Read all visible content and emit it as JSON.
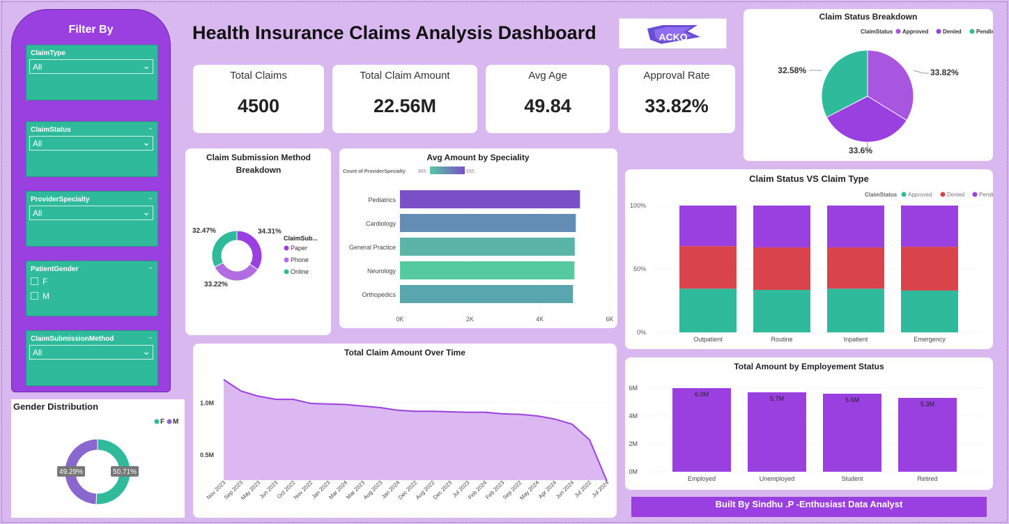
{
  "title": "Health Insurance Claims Analysis Dashboard",
  "logo_text": "ACKO",
  "colors": {
    "purple": "#9a3fe0",
    "teal": "#2fba9c",
    "red": "#d9434b",
    "light_purple": "#d9b8f0",
    "violet": "#a855e0"
  },
  "filter": {
    "title": "Filter By",
    "slicers": [
      {
        "label": "ClaimType",
        "value": "All"
      },
      {
        "label": "ClaimStatus",
        "value": "All"
      },
      {
        "label": "ProviderSpecialty",
        "value": "All"
      },
      {
        "label": "PatientGender",
        "options": [
          "F",
          "M"
        ]
      },
      {
        "label": "ClaimSubmissionMethod",
        "value": "All"
      }
    ]
  },
  "kpis": [
    {
      "label": "Total Claims",
      "value": "4500"
    },
    {
      "label": "Total Claim Amount",
      "value": "22.56M"
    },
    {
      "label": "Avg Age",
      "value": "49.84"
    },
    {
      "label": "Approval Rate",
      "value": "33.82%"
    }
  ],
  "footer": "Built By Sindhu .P -Enthusiast Data Analyst",
  "chart_data": [
    {
      "id": "claim_status_breakdown",
      "type": "pie",
      "title": "Claim Status Breakdown",
      "legend_title": "ClaimStatus",
      "legend_position": "top-right",
      "labels": [
        "Approved",
        "Denied",
        "Pending"
      ],
      "values": [
        33.82,
        33.6,
        32.58
      ],
      "value_labels": [
        "33.82%",
        "33.6%",
        "32.58%"
      ],
      "colors": [
        "#a855e0",
        "#9a3fe0",
        "#2fba9c"
      ]
    },
    {
      "id": "submission_method",
      "type": "pie",
      "title": "Claim Submission Method Breakdown",
      "legend_title": "ClaimSub...",
      "legend_position": "right",
      "labels": [
        "Paper",
        "Phone",
        "Online"
      ],
      "values": [
        34.31,
        33.22,
        32.47
      ],
      "value_labels": [
        "34.31%",
        "33.22%",
        "32.47%"
      ],
      "colors": [
        "#9a3fe0",
        "#b06ce0",
        "#2fba9c"
      ]
    },
    {
      "id": "avg_amount_speciality",
      "type": "bar",
      "orientation": "horizontal",
      "title": "Avg Amount by Speciality",
      "legend_title": "Count of ProviderSpecialty",
      "legend_range": [
        "865",
        "955"
      ],
      "categories": [
        "Pediatrics",
        "Cardiology",
        "General Practice",
        "Neurology",
        "Orthopedics"
      ],
      "values": [
        5150,
        5030,
        5000,
        4990,
        4950
      ],
      "colors": [
        "#7a4fc8",
        "#648db5",
        "#5ab4a8",
        "#55c9a0",
        "#5aa6ae"
      ],
      "xlim": [
        0,
        6000
      ],
      "x_ticks": [
        "0K",
        "2K",
        "4K",
        "6K"
      ]
    },
    {
      "id": "status_vs_type",
      "type": "bar",
      "stacked": "percent",
      "title": "Claim Status VS Claim Type",
      "legend_title": "ClaimStatus",
      "legend_position": "top-right",
      "categories": [
        "Outpatient",
        "Routine",
        "Inpatient",
        "Emergency"
      ],
      "series": [
        {
          "name": "Approved",
          "values": [
            34.5,
            33.5,
            34.5,
            33
          ],
          "color": "#2fba9c"
        },
        {
          "name": "Denied",
          "values": [
            33.5,
            33.5,
            32.5,
            34.5
          ],
          "color": "#d9434b"
        },
        {
          "name": "Pending",
          "values": [
            32,
            33,
            33,
            32.5
          ],
          "color": "#9a3fe0"
        }
      ],
      "y_ticks": [
        "0%",
        "50%",
        "100%"
      ]
    },
    {
      "id": "amount_over_time",
      "type": "area",
      "title": "Total Claim Amount Over Time",
      "x": [
        "Nov 2023",
        "Sep 2023",
        "May 2023",
        "Jun 2023",
        "Oct 2022",
        "Nov 2022",
        "Jan 2023",
        "Mar 2024",
        "Mar 2023",
        "Aug 2023",
        "Jan 2024",
        "Dec 2022",
        "Aug 2022",
        "Dec 2023",
        "Jul 2023",
        "Feb 2024",
        "Feb 2023",
        "Sep 2022",
        "May 2024",
        "Apr 2024",
        "Jun 2024",
        "Jul 2022",
        "Jul 2024"
      ],
      "values": [
        1.22,
        1.11,
        1.06,
        1.03,
        1.03,
        0.99,
        0.985,
        0.98,
        0.965,
        0.95,
        0.925,
        0.915,
        0.915,
        0.91,
        0.905,
        0.905,
        0.89,
        0.885,
        0.87,
        0.84,
        0.79,
        0.64,
        0.24
      ],
      "y_ticks": [
        "0.5M",
        "1.0M"
      ],
      "ylim": [
        0.25,
        1.3
      ]
    },
    {
      "id": "employment_status",
      "type": "bar",
      "title": "Total Amount by Employement Status",
      "categories": [
        "Employed",
        "Unemployed",
        "Student",
        "Retired"
      ],
      "values": [
        6.0,
        5.7,
        5.6,
        5.3
      ],
      "value_labels": [
        "6.0M",
        "5.7M",
        "5.6M",
        "5.3M"
      ],
      "y_ticks": [
        "0M",
        "2M",
        "4M",
        "6M"
      ],
      "ylim": [
        0,
        6.5
      ],
      "color": "#9a3fe0"
    },
    {
      "id": "gender_distribution",
      "type": "pie",
      "title": "Gender Distribution",
      "labels": [
        "F",
        "M"
      ],
      "values": [
        50.71,
        49.29
      ],
      "value_labels": [
        "50.71%",
        "49.29%"
      ],
      "colors": [
        "#2fba9c",
        "#8a67cf"
      ],
      "legend_position": "top-right"
    }
  ]
}
